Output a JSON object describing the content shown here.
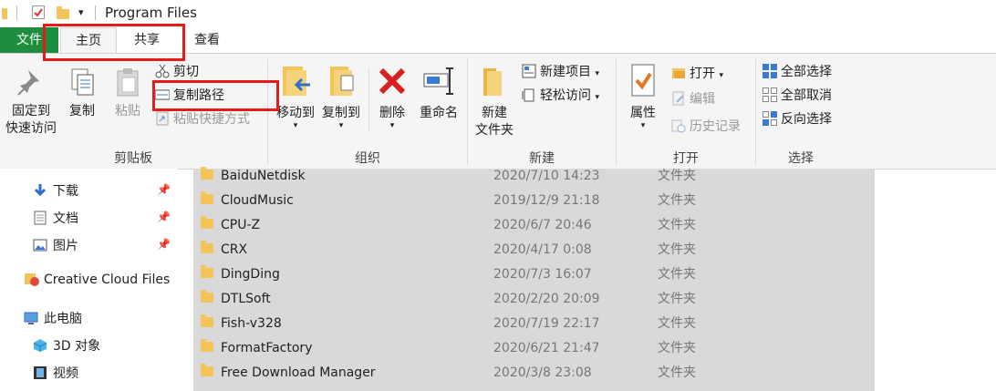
{
  "window": {
    "title": "Program Files"
  },
  "quick_access": {
    "icons": [
      "folder-icon",
      "properties-check-icon",
      "new-folder-icon",
      "customize-dropdown-icon"
    ]
  },
  "tabs": {
    "file": "文件",
    "home": "主页",
    "share": "共享",
    "view": "查看"
  },
  "ribbon": {
    "clipboard": {
      "label": "剪贴板",
      "pin": [
        "固定到",
        "快速访问"
      ],
      "copy": "复制",
      "paste": "粘贴",
      "cut": "剪切",
      "copy_path": "复制路径",
      "paste_shortcut": "粘贴快捷方式"
    },
    "organize": {
      "label": "组织",
      "move_to": "移动到",
      "copy_to": "复制到",
      "delete": "删除",
      "rename": "重命名"
    },
    "new": {
      "label": "新建",
      "new_folder": [
        "新建",
        "文件夹"
      ],
      "new_item": "新建项目",
      "easy_access": "轻松访问"
    },
    "open": {
      "label": "打开",
      "properties": "属性",
      "open": "打开",
      "edit": "编辑",
      "history": "历史记录"
    },
    "select": {
      "label": "选择",
      "select_all": "全部选择",
      "select_none": "全部取消",
      "invert": "反向选择"
    }
  },
  "sidebar": {
    "items": [
      {
        "label": "下载",
        "icon": "download-arrow-icon",
        "pinned": true
      },
      {
        "label": "文档",
        "icon": "document-icon",
        "pinned": true
      },
      {
        "label": "图片",
        "icon": "picture-icon",
        "pinned": true
      },
      {
        "label": "Creative Cloud Files",
        "icon": "creative-cloud-folder-icon",
        "pinned": false
      },
      {
        "label": "此电脑",
        "icon": "computer-icon",
        "pinned": false
      },
      {
        "label": "3D 对象",
        "icon": "3d-cube-icon",
        "pinned": false
      },
      {
        "label": "视频",
        "icon": "video-film-icon",
        "pinned": false
      }
    ]
  },
  "files": [
    {
      "name": "BaiduNetdisk",
      "date": "2020/7/10 14:23",
      "type": "文件夹"
    },
    {
      "name": "CloudMusic",
      "date": "2019/12/9 21:18",
      "type": "文件夹"
    },
    {
      "name": "CPU-Z",
      "date": "2020/6/7 20:46",
      "type": "文件夹"
    },
    {
      "name": "CRX",
      "date": "2020/4/17 0:08",
      "type": "文件夹"
    },
    {
      "name": "DingDing",
      "date": "2020/7/3 16:07",
      "type": "文件夹"
    },
    {
      "name": "DTLSoft",
      "date": "2020/2/20 20:09",
      "type": "文件夹"
    },
    {
      "name": "Fish-v328",
      "date": "2020/7/19 22:17",
      "type": "文件夹"
    },
    {
      "name": "FormatFactory",
      "date": "2020/6/21 21:47",
      "type": "文件夹"
    },
    {
      "name": "Free Download Manager",
      "date": "2020/3/8 23:08",
      "type": "文件夹"
    }
  ],
  "colors": {
    "file_tab": "#1e8e3e",
    "highlight_box": "#e31b1b",
    "selection": "#d9d9d9",
    "folder": "#f2c45a"
  }
}
